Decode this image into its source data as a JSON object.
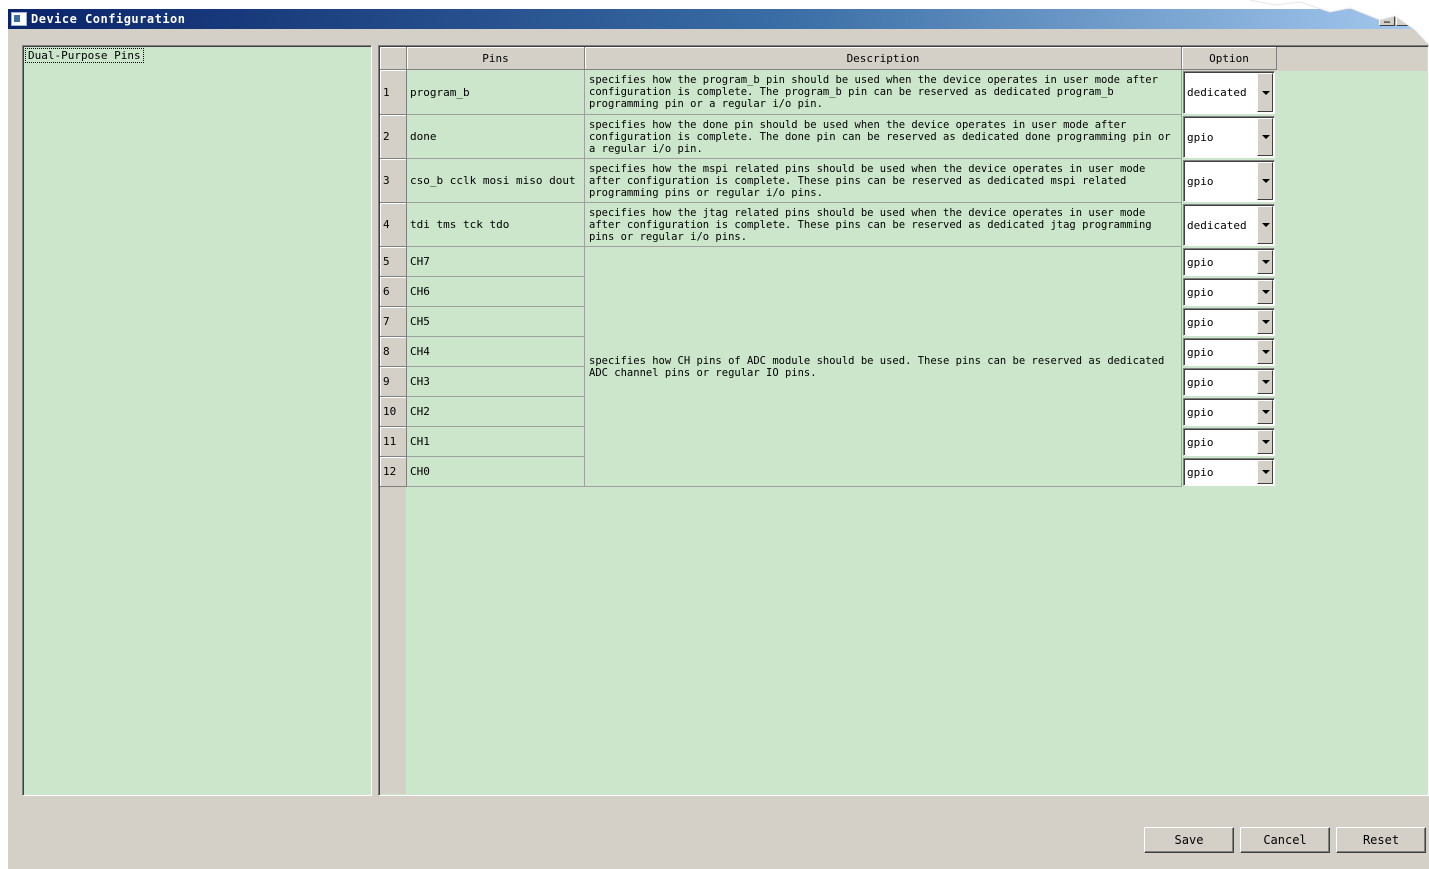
{
  "window": {
    "title": "Device Configuration",
    "controls": {
      "minimize": "_",
      "maximize": "□",
      "close": "×"
    }
  },
  "tree": {
    "items": [
      {
        "label": "Dual-Purpose Pins"
      }
    ]
  },
  "table": {
    "columns": {
      "pins": "Pins",
      "description": "Description",
      "option": "Option"
    },
    "rows": [
      {
        "num": "1",
        "pin": "program_b",
        "option": "dedicated",
        "description": "specifies how the program_b pin should be used when the device operates in user mode after configuration is complete. The program_b pin can be reserved as dedicated program_b programming pin or a regular i/o pin."
      },
      {
        "num": "2",
        "pin": "done",
        "option": "gpio",
        "description": "specifies how the done pin should be used when the device operates in user mode after configuration is complete. The done pin can be reserved as dedicated done programming pin or a regular i/o pin."
      },
      {
        "num": "3",
        "pin": "cso_b cclk mosi miso dout",
        "option": "gpio",
        "description": "specifies how the mspi related pins should be used when the device operates in user mode after configuration is complete. These pins can be reserved as dedicated mspi related programming pins or regular i/o pins."
      },
      {
        "num": "4",
        "pin": "tdi tms tck tdo",
        "option": "dedicated",
        "description": "specifies how the jtag related pins should be used when the device operates in user mode after configuration is complete. These pins can be reserved as dedicated jtag programming pins or regular i/o pins."
      },
      {
        "num": "5",
        "pin": "CH7",
        "option": "gpio"
      },
      {
        "num": "6",
        "pin": "CH6",
        "option": "gpio"
      },
      {
        "num": "7",
        "pin": "CH5",
        "option": "gpio"
      },
      {
        "num": "8",
        "pin": "CH4",
        "option": "gpio"
      },
      {
        "num": "9",
        "pin": "CH3",
        "option": "gpio"
      },
      {
        "num": "10",
        "pin": "CH2",
        "option": "gpio"
      },
      {
        "num": "11",
        "pin": "CH1",
        "option": "gpio"
      },
      {
        "num": "12",
        "pin": "CH0",
        "option": "gpio"
      }
    ],
    "ch_description": "specifies how CH pins of ADC module should be used. These pins can be reserved as dedicated ADC channel pins or regular IO pins."
  },
  "buttons": {
    "save": "Save",
    "cancel": "Cancel",
    "reset": "Reset"
  },
  "colors": {
    "grid_background": "#cce6cc",
    "title_start": "#0a246a",
    "title_end": "#a6caf0",
    "face": "#d4d0c8"
  }
}
